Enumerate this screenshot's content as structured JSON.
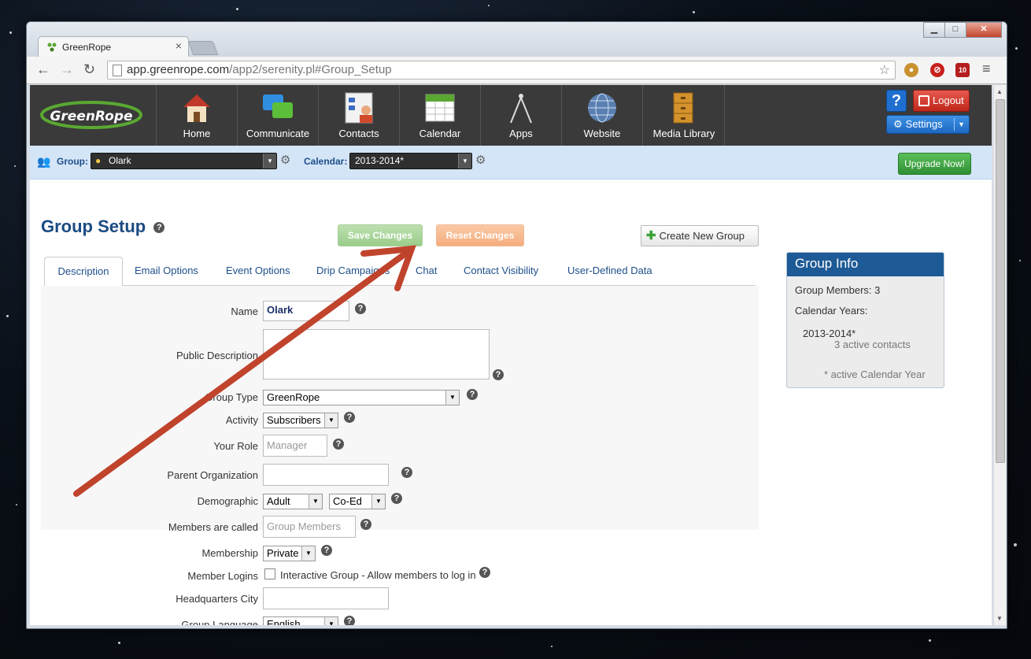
{
  "browser": {
    "tab_title": "GreenRope",
    "url_host": "app.greenrope.com",
    "url_path": "/app2/serenity.pl#Group_Setup",
    "badge_count": "10"
  },
  "nav": {
    "logo": "GreenRope",
    "items": [
      {
        "label": "Home"
      },
      {
        "label": "Communicate"
      },
      {
        "label": "Contacts"
      },
      {
        "label": "Calendar"
      },
      {
        "label": "Apps"
      },
      {
        "label": "Website"
      },
      {
        "label": "Media Library"
      }
    ],
    "help_label": "?",
    "logout_label": "Logout",
    "settings_label": "Settings"
  },
  "groupbar": {
    "group_label": "Group:",
    "group_value": "Olark",
    "calendar_label": "Calendar:",
    "calendar_value": "2013-2014*",
    "upgrade_label": "Upgrade Now!"
  },
  "page": {
    "title": "Group Setup",
    "save_label": "Save Changes",
    "reset_label": "Reset Changes",
    "create_label": "Create New Group",
    "tabs": [
      "Description",
      "Email Options",
      "Event Options",
      "Drip Campaigns",
      "Chat",
      "Contact Visibility",
      "User-Defined Data"
    ]
  },
  "form": {
    "name_label": "Name",
    "name_value": "Olark",
    "public_description_label": "Public Description",
    "group_type_label": "Group Type",
    "group_type_value": "GreenRope",
    "activity_label": "Activity",
    "activity_value": "Subscribers",
    "your_role_label": "Your Role",
    "your_role_placeholder": "Manager",
    "parent_org_label": "Parent Organization",
    "demographic_label": "Demographic",
    "demographic_age": "Adult",
    "demographic_gender": "Co-Ed",
    "members_called_label": "Members are called",
    "members_called_placeholder": "Group Members",
    "membership_label": "Membership",
    "membership_value": "Private",
    "member_logins_label": "Member Logins",
    "member_logins_text": "Interactive Group - Allow members to log in",
    "hq_city_label": "Headquarters City",
    "group_language_label": "Group Language",
    "group_language_value": "English"
  },
  "group_info": {
    "title": "Group Info",
    "members": "Group Members: 3",
    "calendar_years_label": "Calendar Years:",
    "year": "2013-2014*",
    "active_contacts": "3 active contacts",
    "footnote": "* active Calendar Year"
  },
  "annotation": {
    "arrow_color": "#c0432c"
  }
}
